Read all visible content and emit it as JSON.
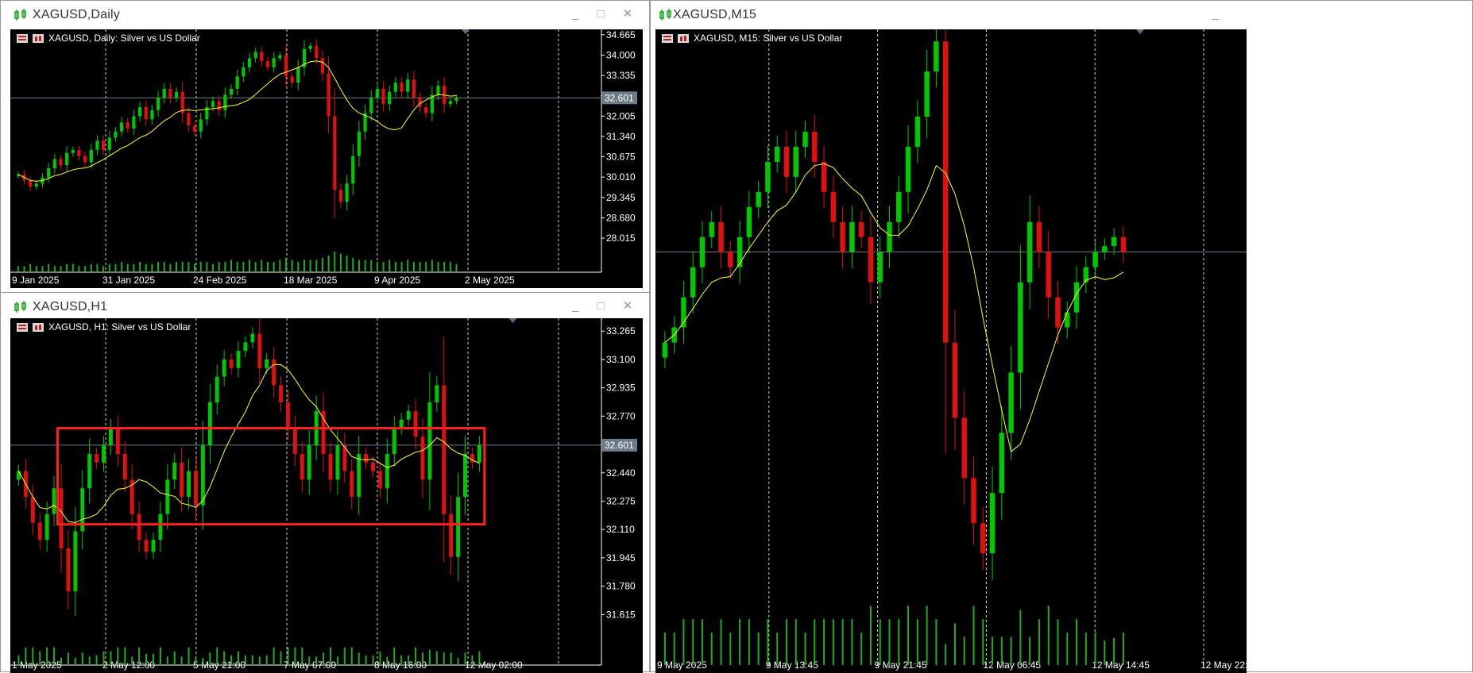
{
  "colors": {
    "up": "#00c800",
    "down": "#e01010",
    "ma": "#ffff30",
    "grid": "#ffffff",
    "price_line": "#6e7e8a",
    "price_tag_bg": "#6c7b88",
    "volume": "#22aa22",
    "highlight_box": "#ff2020"
  },
  "windows": [
    {
      "id": "daily",
      "title": "XAGUSD,Daily",
      "legend": "XAGUSD, Daily:  Silver vs US Dollar",
      "icon": "chart-candles-icon",
      "price_tag": "32.601",
      "chart_data": {
        "type": "candlestick",
        "symbol": "XAGUSD",
        "timeframe": "Daily",
        "ylim": [
          27.68,
          34.84
        ],
        "current_price": 32.601,
        "y_ticks": [
          "34.665",
          "34.000",
          "33.335",
          "32.670",
          "32.005",
          "31.340",
          "30.675",
          "30.010",
          "29.345",
          "28.680",
          "28.015"
        ],
        "x_ticks": [
          "9 Jan 2025",
          "31 Jan 2025",
          "24 Feb 2025",
          "18 Mar 2025",
          "9 Apr 2025",
          "2 May 2025"
        ],
        "series": [
          {
            "name": "XAGUSD",
            "close": [
              30.1,
              29.9,
              29.7,
              29.8,
              30.0,
              30.3,
              30.6,
              30.4,
              30.8,
              30.9,
              30.7,
              30.5,
              30.9,
              31.2,
              30.9,
              31.3,
              31.5,
              31.8,
              31.6,
              32.0,
              32.3,
              31.9,
              32.2,
              32.6,
              32.9,
              32.6,
              32.8,
              32.1,
              31.7,
              31.5,
              31.9,
              32.3,
              32.5,
              32.2,
              32.7,
              32.9,
              33.3,
              33.6,
              33.9,
              34.1,
              33.8,
              33.6,
              33.9,
              34.0,
              33.3,
              33.1,
              33.6,
              34.2,
              34.3,
              33.9,
              33.4,
              32.0,
              29.6,
              29.2,
              29.8,
              30.7,
              31.5,
              32.1,
              32.6,
              32.9,
              32.4,
              32.8,
              33.1,
              32.8,
              33.2,
              32.6,
              32.3,
              32.1,
              32.7,
              33.0,
              32.4,
              32.5,
              32.6
            ],
            "volume": [
              0.3,
              0.3,
              0.4,
              0.3,
              0.3,
              0.4,
              0.3,
              0.3,
              0.4,
              0.4,
              0.3,
              0.3,
              0.4,
              0.4,
              0.3,
              0.4,
              0.4,
              0.5,
              0.4,
              0.4,
              0.5,
              0.4,
              0.4,
              0.5,
              0.5,
              0.4,
              0.5,
              0.5,
              0.5,
              0.4,
              0.5,
              0.5,
              0.4,
              0.5,
              0.5,
              0.6,
              0.5,
              0.5,
              0.6,
              0.5,
              0.6,
              0.5,
              0.5,
              0.6,
              0.7,
              0.6,
              0.5,
              0.6,
              0.6,
              0.6,
              0.7,
              0.8,
              1.0,
              0.9,
              0.8,
              0.7,
              0.6,
              0.6,
              0.6,
              0.5,
              0.5,
              0.6,
              0.5,
              0.5,
              0.6,
              0.5,
              0.5,
              0.5,
              0.6,
              0.5,
              0.5,
              0.5,
              0.4
            ]
          }
        ],
        "ma_label": "moving average"
      }
    },
    {
      "id": "h1",
      "title": "XAGUSD,H1",
      "legend": "XAGUSD, H1:  Silver vs US Dollar",
      "icon": "chart-candles-icon",
      "price_tag": "32.601",
      "chart_data": {
        "type": "candlestick",
        "symbol": "XAGUSD",
        "timeframe": "H1",
        "ylim": [
          31.45,
          33.34
        ],
        "current_price": 32.601,
        "highlight_range": [
          32.14,
          32.7
        ],
        "y_ticks": [
          "33.265",
          "33.100",
          "32.935",
          "32.770",
          "32.605",
          "32.440",
          "32.275",
          "32.110",
          "31.945",
          "31.780",
          "31.615"
        ],
        "x_ticks": [
          "1 May 2025",
          "2 May 12:00",
          "5 May 21:00",
          "7 May 07:00",
          "8 May 16:00",
          "12 May 02:00"
        ],
        "series": [
          {
            "name": "XAGUSD",
            "close": [
              32.45,
              32.3,
              32.15,
              32.05,
              32.2,
              32.35,
              32.0,
              31.75,
              32.1,
              32.35,
              32.55,
              32.5,
              32.6,
              32.7,
              32.55,
              32.4,
              32.2,
              32.05,
              31.98,
              32.05,
              32.2,
              32.4,
              32.5,
              32.3,
              32.45,
              32.25,
              32.6,
              32.85,
              33.0,
              33.1,
              33.05,
              33.15,
              33.2,
              33.25,
              33.05,
              33.1,
              32.95,
              32.85,
              32.7,
              32.55,
              32.4,
              32.6,
              32.8,
              32.55,
              32.4,
              32.6,
              32.45,
              32.3,
              32.55,
              32.5,
              32.45,
              32.35,
              32.55,
              32.7,
              32.75,
              32.8,
              32.65,
              32.4,
              32.85,
              32.95,
              32.2,
              31.95,
              32.3,
              32.55,
              32.5,
              32.6
            ]
          }
        ]
      }
    },
    {
      "id": "m15",
      "title": "XAGUSD,M15",
      "legend": "XAGUSD, M15:  Silver vs US Dollar",
      "icon": "chart-candles-icon",
      "chart_data": {
        "type": "candlestick",
        "symbol": "XAGUSD",
        "timeframe": "M15",
        "ylim": [
          31.45,
          33.34
        ],
        "current_price": 32.601,
        "x_ticks": [
          "9 May 2025",
          "9 May 13:45",
          "9 May 21:45",
          "12 May 06:45",
          "12 May 14:45",
          "12 May 22:45"
        ],
        "series": [
          {
            "name": "XAGUSD",
            "close": [
              32.3,
              32.35,
              32.45,
              32.55,
              32.65,
              32.7,
              32.6,
              32.55,
              32.65,
              32.75,
              32.8,
              32.9,
              32.95,
              32.85,
              32.95,
              33.0,
              32.9,
              32.8,
              32.7,
              32.6,
              32.7,
              32.65,
              32.5,
              32.6,
              32.7,
              32.8,
              32.95,
              33.05,
              33.2,
              33.3,
              32.3,
              32.05,
              31.85,
              31.7,
              31.6,
              31.8,
              32.0,
              32.2,
              32.5,
              32.7,
              32.6,
              32.45,
              32.35,
              32.4,
              32.5,
              32.55,
              32.6,
              32.62,
              32.65,
              32.6
            ]
          }
        ]
      }
    }
  ]
}
